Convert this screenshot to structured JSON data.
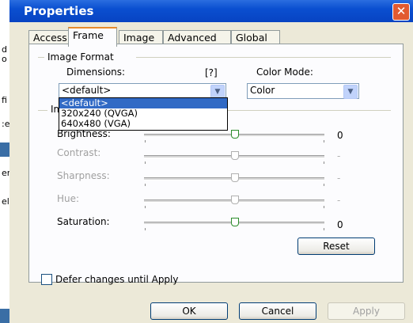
{
  "background": {
    "fragments": [
      "d",
      "o",
      "fi",
      ":e",
      "er",
      "ele"
    ]
  },
  "dialog": {
    "title": "Properties",
    "close_glyph": "✕"
  },
  "tabs": [
    "Access",
    "Frame",
    "Image",
    "Advanced",
    "Global"
  ],
  "active_tab": "Frame",
  "image_format": {
    "group_label": "Image Format",
    "dimensions_label": "Dimensions:",
    "help_label": "[?]",
    "color_mode_label": "Color Mode:",
    "dimensions_value": "<default>",
    "color_mode_value": "Color",
    "dimension_options": [
      "<default>",
      "320x240 (QVGA)",
      "640x480 (VGA)"
    ],
    "selected_option": "<default>"
  },
  "image_group_partial_label": "Im",
  "sliders": [
    {
      "label": "Brightness:",
      "value_text": "0",
      "enabled": true,
      "level": 0.5
    },
    {
      "label": "Contrast:",
      "value_text": "-",
      "enabled": false,
      "level": 0.5
    },
    {
      "label": "Sharpness:",
      "value_text": "-",
      "enabled": false,
      "level": 0.5
    },
    {
      "label": "Hue:",
      "value_text": "-",
      "enabled": false,
      "level": 0.5
    },
    {
      "label": "Saturation:",
      "value_text": "0",
      "enabled": true,
      "level": 0.5
    }
  ],
  "reset_label": "Reset",
  "defer_label": "Defer changes until Apply",
  "defer_checked": false,
  "buttons": {
    "ok": "OK",
    "cancel": "Cancel",
    "apply": "Apply"
  }
}
